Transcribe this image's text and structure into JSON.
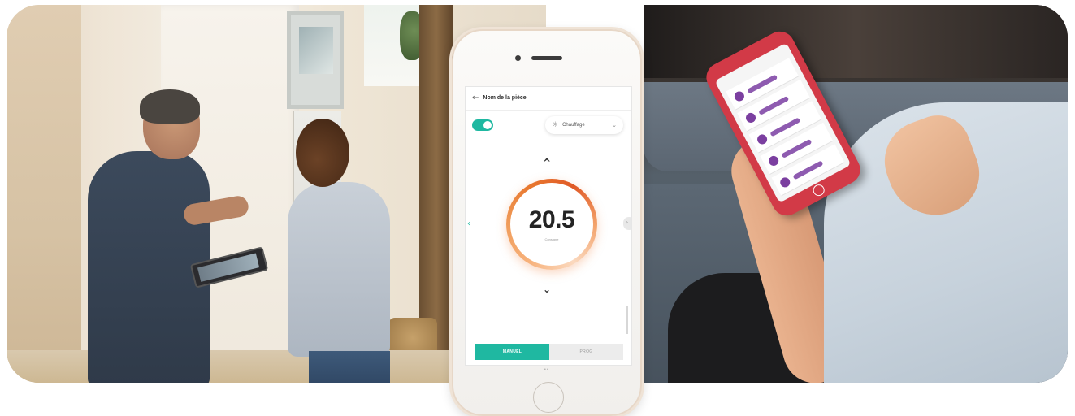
{
  "app": {
    "room_name": "Nom de la pièce",
    "mode_selected": "Chauffage",
    "temperature": "20.5",
    "temperature_sub": "Consigne",
    "tabs": [
      {
        "label": "MANUEL",
        "active": true
      },
      {
        "label": "PROG",
        "active": false
      }
    ],
    "accent_color": "#1fb8a1",
    "dial_color": "#e8782f"
  }
}
